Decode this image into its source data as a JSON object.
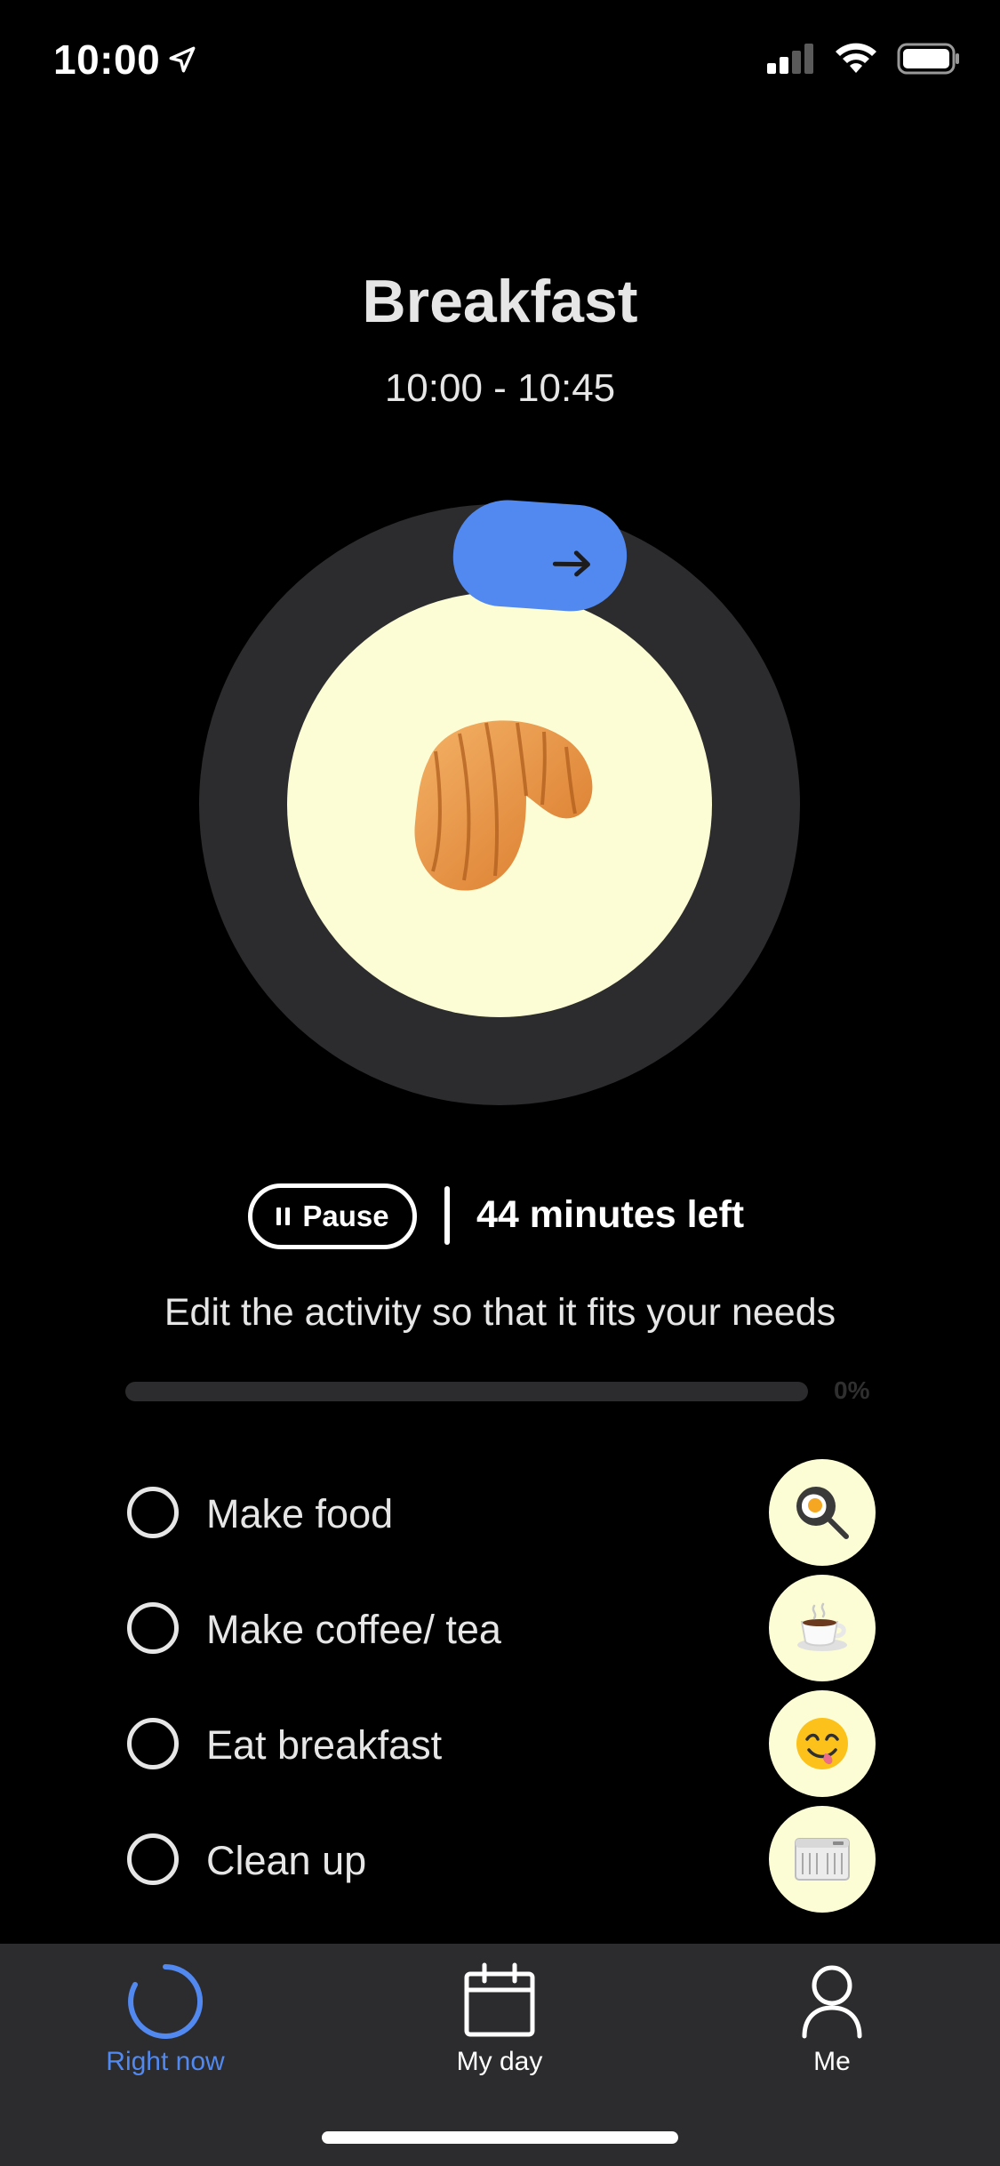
{
  "status_bar": {
    "time": "10:00",
    "location_icon": "location-arrow-icon",
    "signal_icon": "cellular-signal-icon",
    "wifi_icon": "wifi-icon",
    "battery_icon": "battery-icon"
  },
  "activity": {
    "title": "Breakfast",
    "time_range": "10:00 - 10:45",
    "icon": "croissant-icon"
  },
  "controls": {
    "pause_label": "Pause",
    "time_left": "44 minutes left"
  },
  "hint": "Edit the activity so that it fits your needs",
  "progress": {
    "value": 0,
    "label": "0%"
  },
  "tasks": [
    {
      "label": "Make food",
      "icon": "fried-egg-pan-icon",
      "done": false
    },
    {
      "label": "Make coffee/ tea",
      "icon": "coffee-cup-icon",
      "done": false
    },
    {
      "label": "Eat breakfast",
      "icon": "yummy-face-icon",
      "done": false
    },
    {
      "label": "Clean up",
      "icon": "dishwasher-icon",
      "done": false
    }
  ],
  "tabbar": {
    "tabs": [
      {
        "label": "Right now",
        "icon": "progress-ring-icon",
        "active": true
      },
      {
        "label": "My day",
        "icon": "calendar-icon",
        "active": false
      },
      {
        "label": "Me",
        "icon": "person-icon",
        "active": false
      }
    ]
  },
  "colors": {
    "accent": "#5189f0",
    "background": "#000000",
    "surface": "#2c2c2e",
    "highlight": "#fdfdd5"
  }
}
